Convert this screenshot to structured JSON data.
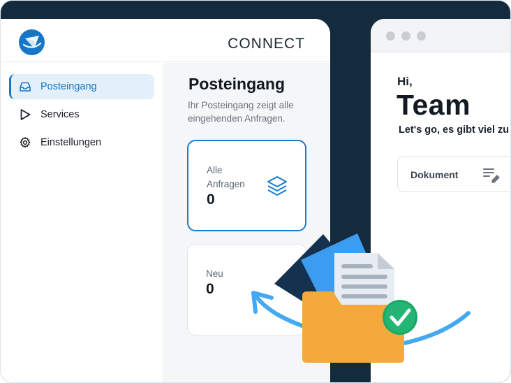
{
  "app": {
    "brand": "CONNECT",
    "logo_icon": "paper-plane-logo-icon"
  },
  "sidebar": {
    "items": [
      {
        "label": "Posteingang",
        "icon": "inbox-icon",
        "active": true
      },
      {
        "label": "Services",
        "icon": "play-triangle-icon",
        "active": false
      },
      {
        "label": "Einstellungen",
        "icon": "gear-icon",
        "active": false
      }
    ]
  },
  "main": {
    "title": "Posteingang",
    "description": "Ihr Posteingang zeigt alle eingehenden Anfragen.",
    "cards": [
      {
        "label": "Alle Anfragen",
        "value": "0",
        "icon": "layers-icon",
        "selected": true
      },
      {
        "label": "Neu",
        "value": "0",
        "selected": false
      }
    ]
  },
  "browser": {
    "greeting": "Hi,",
    "name": "Team",
    "subtitle": "Let's go, es gibt viel zu tun.",
    "field_label": "Dokument",
    "field_icon": "edit-list-icon"
  },
  "colors": {
    "accent": "#1577c6",
    "background": "#142a3d",
    "folder": "#f5a93a",
    "check": "#22b573",
    "arrow": "#45a8f2"
  }
}
